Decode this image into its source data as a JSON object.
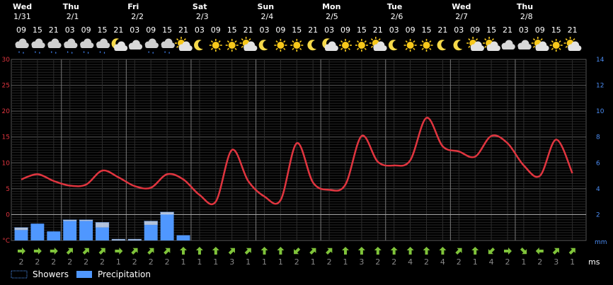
{
  "chart_data": {
    "type": "line",
    "units": {
      "temperature": "°C",
      "precipitation": "mm",
      "wind": "ms"
    },
    "days": [
      {
        "name": "Wed",
        "date": "1/31"
      },
      {
        "name": "Thu",
        "date": "2/1"
      },
      {
        "name": "Fri",
        "date": "2/2"
      },
      {
        "name": "Sat",
        "date": "2/3"
      },
      {
        "name": "Sun",
        "date": "2/4"
      },
      {
        "name": "Mon",
        "date": "2/5"
      },
      {
        "name": "Tue",
        "date": "2/6"
      },
      {
        "name": "Wed",
        "date": "2/7"
      },
      {
        "name": "Thu",
        "date": "2/8"
      }
    ],
    "hours": [
      "09",
      "15",
      "21",
      "03",
      "09",
      "15",
      "21",
      "03",
      "09",
      "15",
      "21",
      "03",
      "09",
      "15",
      "21",
      "03",
      "09",
      "15",
      "21",
      "03",
      "09",
      "15",
      "21",
      "03",
      "09",
      "15",
      "21",
      "03",
      "09",
      "15",
      "21",
      "03",
      "09",
      "15",
      "21"
    ],
    "weather_icons": [
      "rain-cloud",
      "rain-cloud",
      "rain-cloud",
      "rain-cloud",
      "rain-cloud",
      "rain-cloud",
      "partly-cloudy-night",
      "cloud",
      "rain-cloud",
      "rain-cloud",
      "partly-cloudy",
      "clear-night",
      "sun",
      "sun",
      "partly-cloudy",
      "clear-night",
      "sun",
      "sun",
      "clear-night",
      "partly-cloudy-night",
      "sun",
      "sun",
      "partly-cloudy",
      "clear-night",
      "sun",
      "sun",
      "clear-night",
      "clear-night",
      "partly-cloudy",
      "partly-cloudy",
      "cloud",
      "cloud",
      "partly-cloudy",
      "sun",
      "partly-cloudy"
    ],
    "temperature": {
      "axis_ticks": [
        30,
        25,
        20,
        15,
        10,
        5,
        0
      ],
      "axis_bottom_label": "°C",
      "ylim": [
        -5,
        30
      ],
      "values": [
        6.8,
        7.8,
        6.5,
        5.6,
        5.8,
        8.5,
        7.2,
        5.5,
        5.2,
        7.8,
        6.8,
        3.8,
        2.5,
        12.5,
        6.5,
        3.5,
        2.8,
        13.8,
        6.2,
        4.8,
        5.8,
        15.2,
        10.2,
        9.5,
        10.5,
        18.7,
        13.2,
        12.2,
        11.2,
        15.2,
        13.8,
        9.5,
        7.5,
        14.5,
        8.0
      ]
    },
    "precipitation": {
      "axis_ticks": [
        14,
        12,
        10,
        8,
        6,
        4,
        2
      ],
      "axis_bottom_label": "mm",
      "ylim": [
        0,
        14
      ],
      "values": [
        0.8,
        1.3,
        0.7,
        1.5,
        1.5,
        1.0,
        0.0,
        0.0,
        1.2,
        2.0,
        0.4,
        0,
        0,
        0,
        0,
        0,
        0,
        0,
        0,
        0,
        0,
        0,
        0,
        0,
        0,
        0,
        0,
        0,
        0,
        0,
        0,
        0,
        0,
        0,
        0
      ],
      "showers": [
        0.2,
        0,
        0,
        0.1,
        0.1,
        0.4,
        0.1,
        0.1,
        0.3,
        0.2,
        0,
        0,
        0,
        0,
        0,
        0,
        0,
        0,
        0,
        0,
        0,
        0,
        0,
        0,
        0,
        0,
        0,
        0,
        0,
        0,
        0,
        0,
        0,
        0,
        0,
        0,
        0
      ]
    },
    "wind": {
      "direction_icons": [
        "right",
        "right",
        "right",
        "up-right",
        "up-right",
        "up-right",
        "right",
        "up-right",
        "up-right",
        "up-right",
        "up",
        "up",
        "up",
        "up-right",
        "up-right",
        "up",
        "up",
        "down-left",
        "up-right",
        "up-right",
        "up",
        "up",
        "up",
        "up",
        "up",
        "up",
        "up",
        "up-right",
        "up",
        "down-left",
        "right",
        "down-right",
        "left",
        "up-right",
        "up-right"
      ],
      "speeds": [
        2,
        2,
        2,
        2,
        2,
        2,
        1,
        2,
        2,
        2,
        1,
        1,
        1,
        3,
        1,
        1,
        1,
        2,
        1,
        2,
        1,
        3,
        2,
        2,
        4,
        2,
        4,
        2,
        1,
        4,
        2,
        1,
        2,
        3,
        1
      ],
      "unit_label": "ms"
    },
    "legend": [
      {
        "label": "Showers"
      },
      {
        "label": "Precipitation"
      }
    ],
    "colors": {
      "temperature": "#e0353f",
      "precipitation": "#4f97ff",
      "showers": "#cfe2ff",
      "wind": "#7fc33a",
      "axis_right": "#4a8bf0"
    }
  }
}
